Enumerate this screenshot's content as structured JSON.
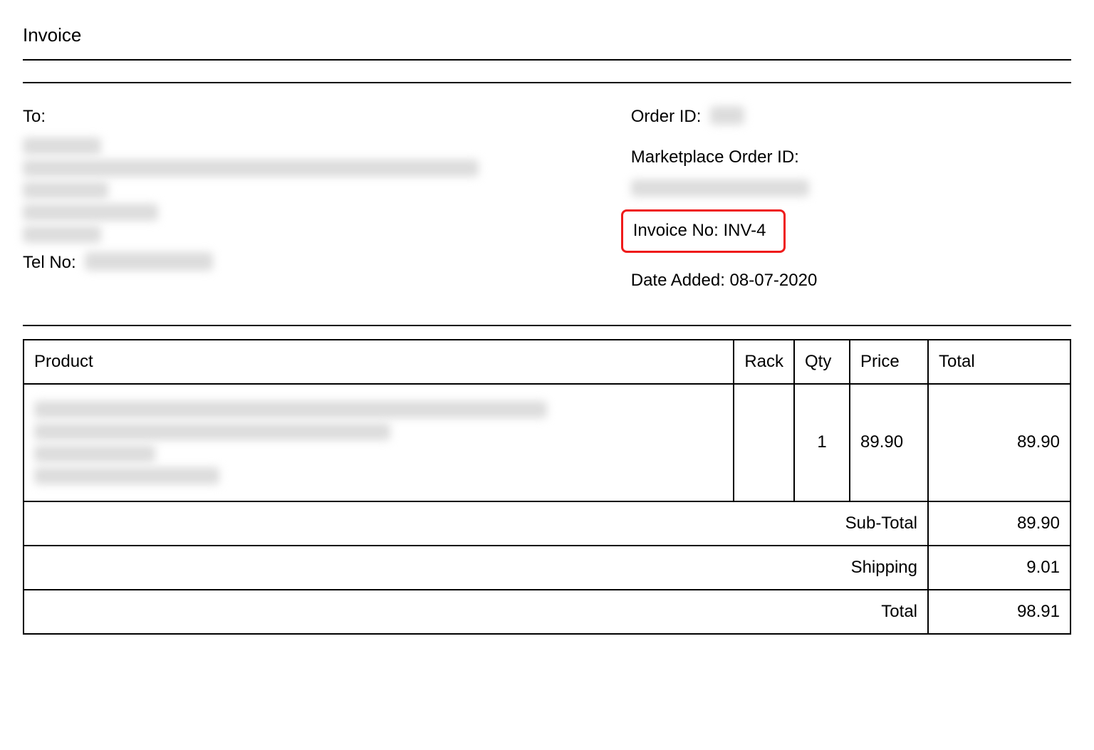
{
  "title": "Invoice",
  "to_label": "To:",
  "tel_label": "Tel No:",
  "order_id_label": "Order ID:",
  "marketplace_label": "Marketplace Order ID:",
  "invoice_no_label": "Invoice No:",
  "invoice_no_value": "INV-4",
  "date_added_label": "Date Added:",
  "date_added_value": "08-07-2020",
  "table": {
    "headers": {
      "product": "Product",
      "rack": "Rack",
      "qty": "Qty",
      "price": "Price",
      "total": "Total"
    },
    "rows": [
      {
        "rack": "",
        "qty": "1",
        "price": "89.90",
        "total": "89.90"
      }
    ],
    "summary": {
      "subtotal_label": "Sub-Total",
      "subtotal_value": "89.90",
      "shipping_label": "Shipping",
      "shipping_value": "9.01",
      "total_label": "Total",
      "total_value": "98.91"
    }
  }
}
